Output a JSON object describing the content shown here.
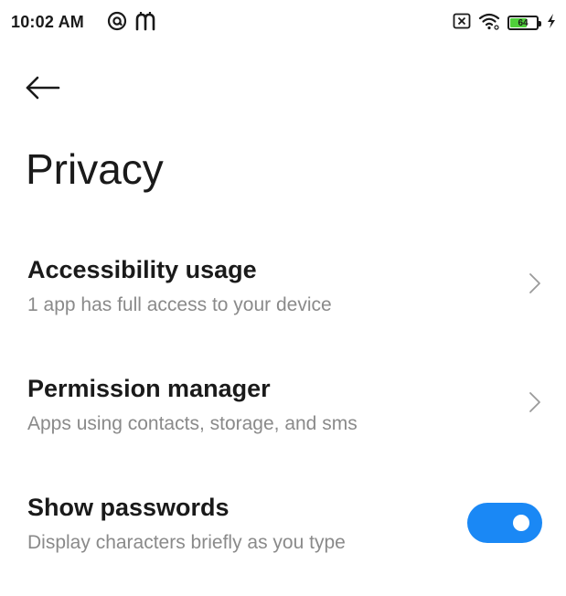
{
  "status_bar": {
    "time": "10:02 AM",
    "left_icons": [
      "at-sign-icon",
      "m-app-icon"
    ],
    "right_icons": [
      "no-sim-icon",
      "wifi-icon",
      "battery-icon",
      "charging-bolt-icon"
    ],
    "battery_level": "64",
    "battery_color": "#4fcf3a"
  },
  "header": {
    "back_icon": "arrow-left-icon",
    "title": "Privacy"
  },
  "settings": {
    "items": [
      {
        "title": "Accessibility usage",
        "subtitle": "1 app has full access to your device",
        "control": "chevron-right-icon"
      },
      {
        "title": "Permission manager",
        "subtitle": "Apps using contacts, storage, and sms",
        "control": "chevron-right-icon"
      },
      {
        "title": "Show passwords",
        "subtitle": "Display characters briefly as you type",
        "control": "toggle",
        "toggle_on": true,
        "toggle_color": "#1a88f5"
      }
    ]
  }
}
